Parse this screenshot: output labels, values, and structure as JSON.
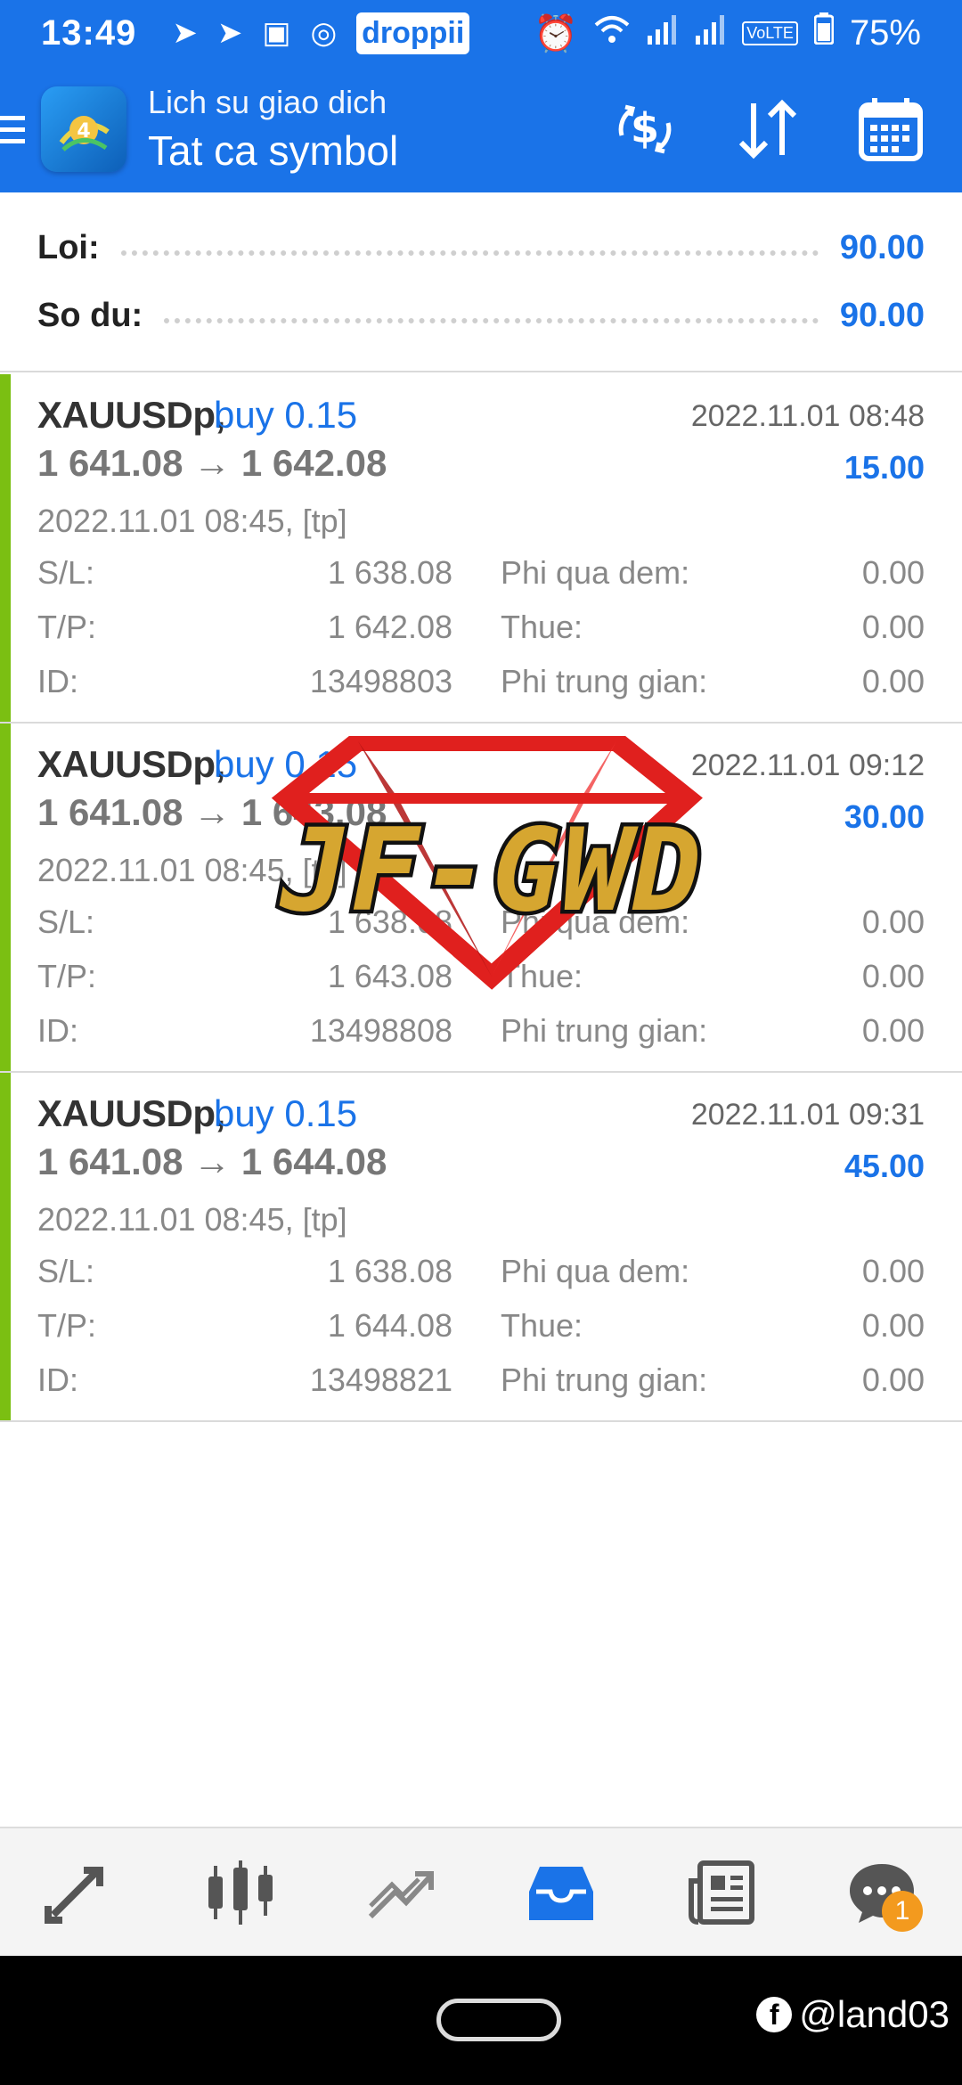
{
  "status_bar": {
    "time": "13:49",
    "notification_icons": [
      "telegram-icon",
      "telegram-icon",
      "shopee-icon",
      "sync-icon",
      "droppii-icon"
    ],
    "droppii_label": "droppii",
    "battery": "75%"
  },
  "header": {
    "subtitle": "Lich su giao dich",
    "title": "Tat ca symbol",
    "actions": [
      "currency-swap-icon",
      "sort-icon",
      "calendar-icon"
    ]
  },
  "summary": {
    "profit_label": "Loi:",
    "profit_value": "90.00",
    "balance_label": "So du:",
    "balance_value": "90.00"
  },
  "trades": [
    {
      "symbol": "XAUUSDp,",
      "direction": "buy 0.15",
      "close_time": "2022.11.01 08:48",
      "prices": "1 641.08 → 1 642.08",
      "profit": "15.00",
      "open_info": "2022.11.01 08:45, [tp]",
      "sl_label": "S/L:",
      "sl": "1 638.08",
      "tp_label": "T/P:",
      "tp": "1 642.08",
      "id_label": "ID:",
      "id": "13498803",
      "swap_label": "Phi qua dem:",
      "swap": "0.00",
      "tax_label": "Thue:",
      "tax": "0.00",
      "commission_label": "Phi trung gian:",
      "commission": "0.00"
    },
    {
      "symbol": "XAUUSDp,",
      "direction": "buy 0.15",
      "close_time": "2022.11.01 09:12",
      "prices": "1 641.08 → 1 643.08",
      "profit": "30.00",
      "open_info": "2022.11.01 08:45, [tp]",
      "sl_label": "S/L:",
      "sl": "1 638.08",
      "tp_label": "T/P:",
      "tp": "1 643.08",
      "id_label": "ID:",
      "id": "13498808",
      "swap_label": "Phi qua dem:",
      "swap": "0.00",
      "tax_label": "Thue:",
      "tax": "0.00",
      "commission_label": "Phi trung gian:",
      "commission": "0.00"
    },
    {
      "symbol": "XAUUSDp,",
      "direction": "buy 0.15",
      "close_time": "2022.11.01 09:31",
      "prices": "1 641.08 → 1 644.08",
      "profit": "45.00",
      "open_info": "2022.11.01 08:45, [tp]",
      "sl_label": "S/L:",
      "sl": "1 638.08",
      "tp_label": "T/P:",
      "tp": "1 644.08",
      "id_label": "ID:",
      "id": "13498821",
      "swap_label": "Phi qua dem:",
      "swap": "0.00",
      "tax_label": "Thue:",
      "tax": "0.00",
      "commission_label": "Phi trung gian:",
      "commission": "0.00"
    }
  ],
  "watermark": {
    "text": "JF-GWD"
  },
  "bottom_nav": {
    "items": [
      "trade-icon",
      "chart-icon",
      "trend-icon",
      "history-icon",
      "news-icon",
      "chat-icon"
    ],
    "active": "history-icon",
    "chat_badge": "1"
  },
  "system_nav": {
    "handle": "@land03"
  },
  "colors": {
    "accent": "#1a73e8",
    "profit_bar": "#7bbf12",
    "badge": "#f39a1e"
  }
}
